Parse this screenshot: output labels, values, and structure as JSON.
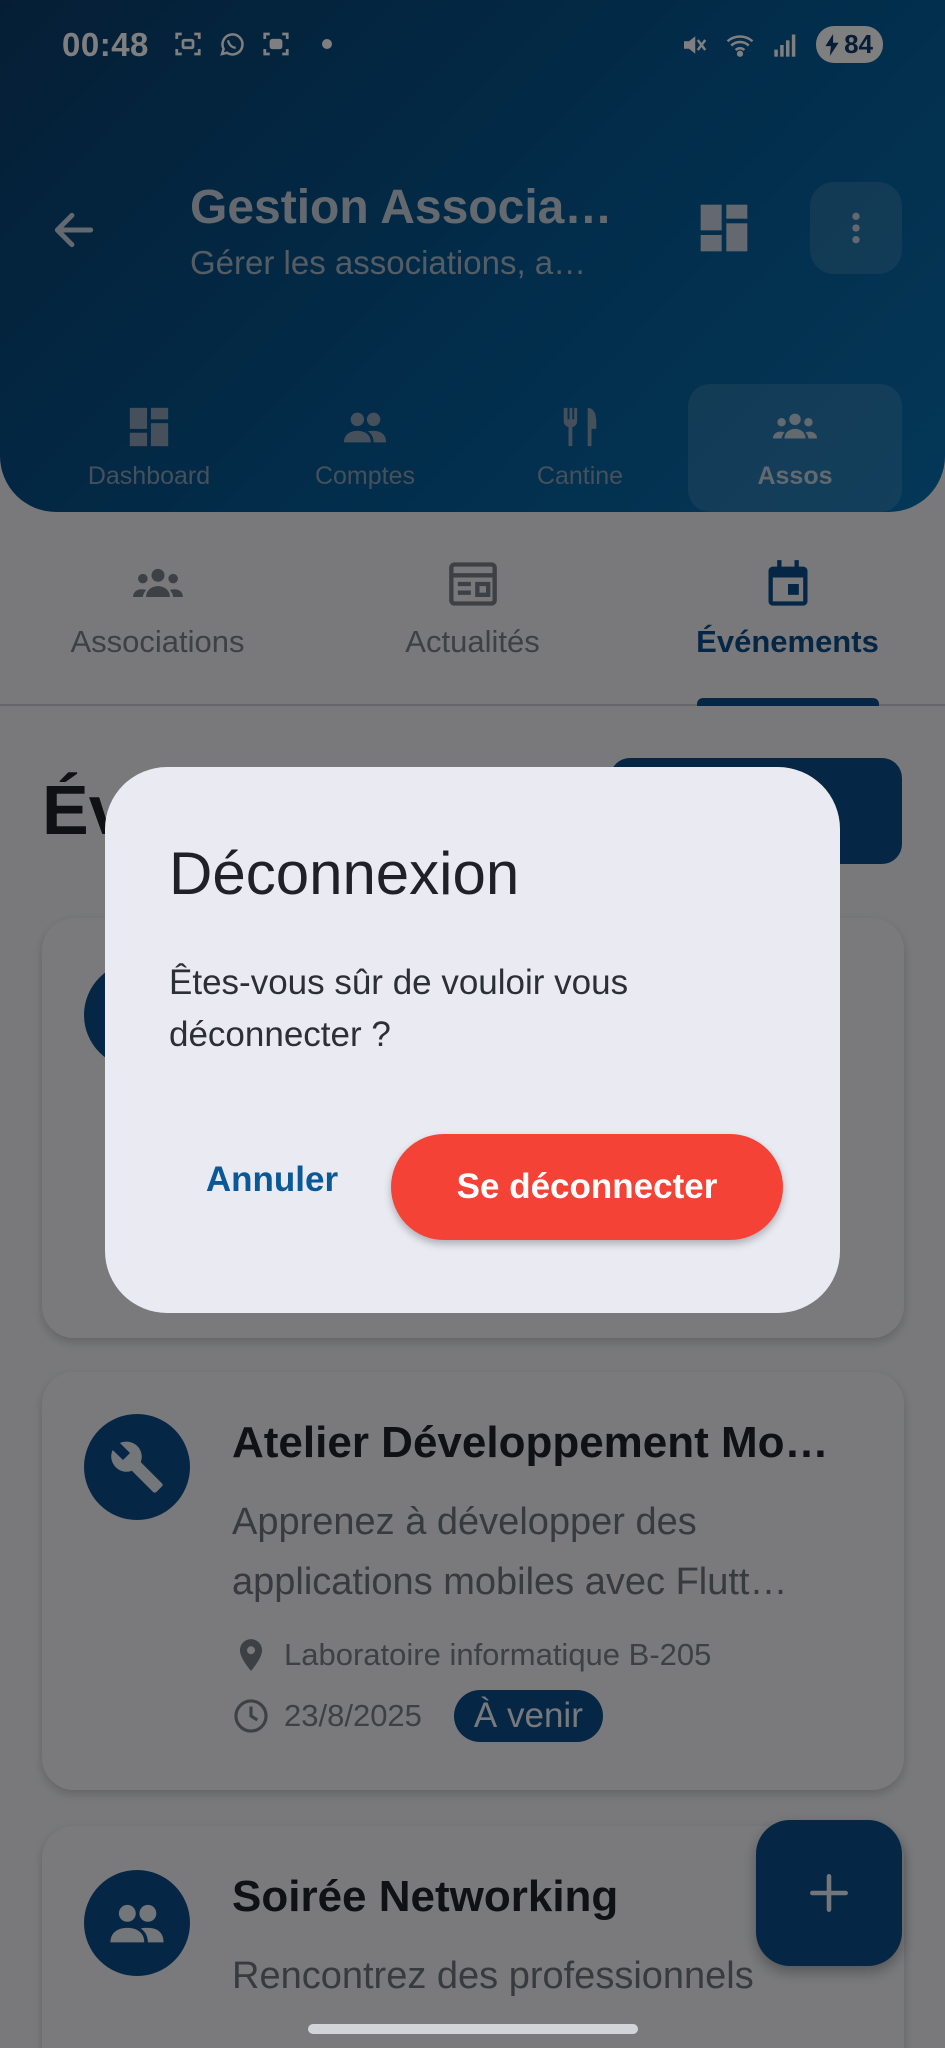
{
  "status_bar": {
    "time": "00:48",
    "battery": "84"
  },
  "header": {
    "title": "Gestion Associa…",
    "subtitle": "Gérer les associations, a…"
  },
  "bottom_nav": [
    {
      "label": "Dashboard",
      "icon": "dashboard-icon"
    },
    {
      "label": "Comptes",
      "icon": "people-icon"
    },
    {
      "label": "Cantine",
      "icon": "restaurant-icon"
    },
    {
      "label": "Assos",
      "icon": "groups-icon",
      "active": true
    }
  ],
  "tabs": [
    {
      "label": "Associations",
      "icon": "groups-icon"
    },
    {
      "label": "Actualités",
      "icon": "newspaper-icon"
    },
    {
      "label": "Événements",
      "icon": "event-icon",
      "active": true
    }
  ],
  "section_title": "Év",
  "events": [
    {
      "title": "Atelier Développement Mo…",
      "description_lines": [
        "Apprenez à développer des",
        "applications mobiles avec Flutt…"
      ],
      "location": "Laboratoire informatique B-205",
      "date": "23/8/2025",
      "status": "À venir",
      "icon": "wrench-icon"
    },
    {
      "title": "Soirée Networking",
      "description_lines": [
        "Rencontrez des professionnels"
      ],
      "icon": "people-icon"
    }
  ],
  "dialog": {
    "title": "Déconnexion",
    "message": "Êtes-vous sûr de vouloir vous déconnecter ?",
    "cancel_label": "Annuler",
    "confirm_label": "Se déconnecter"
  },
  "colors": {
    "primary": "#0a4e8b",
    "danger": "#f44336",
    "dialog_bg": "#e9eaf2"
  }
}
